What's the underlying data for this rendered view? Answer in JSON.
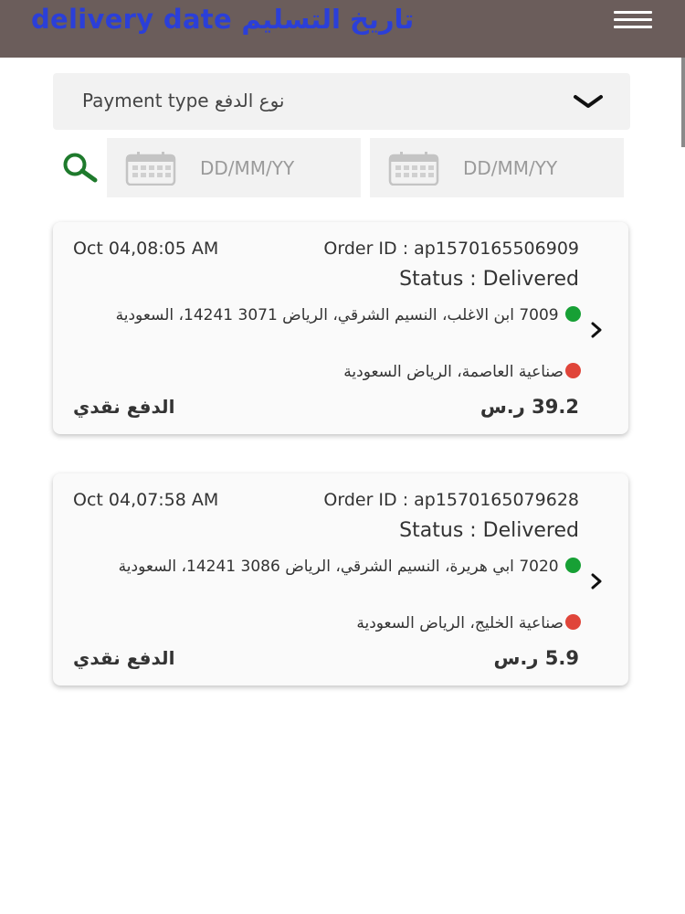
{
  "header": {
    "title": "delivery date تاريخ التسليم",
    "menu_icon": "hamburger-menu-icon"
  },
  "filters": {
    "payment_type_label": "Payment type نوع الدفع",
    "dropdown_icon": "chevron-down-icon",
    "search_icon": "search-icon",
    "date_from_placeholder": "DD/MM/YY",
    "date_to_placeholder": "DD/MM/YY",
    "calendar_icon": "calendar-icon"
  },
  "orders": [
    {
      "datetime": "Oct 04,08:05 AM",
      "order_id": "Order ID : ap1570165506909",
      "status": "Status : Delivered",
      "pickup_address": "7009 ابن الاغلب، النسيم الشرقي، الرياض 3071 14241، السعودية",
      "dropoff_address": "صناعية العاصمة، الرياض السعودية",
      "payment_method": "الدفع نقدي",
      "amount": "39.2 ر.س"
    },
    {
      "datetime": "Oct 04,07:58 AM",
      "order_id": "Order ID : ap1570165079628",
      "status": "Status : Delivered",
      "pickup_address": "7020 ابي هريرة، النسيم الشرقي، الرياض 3086 14241، السعودية",
      "dropoff_address": "صناعية الخليج، الرياض السعودية",
      "payment_method": "الدفع نقدي",
      "amount": "5.9 ر.س"
    }
  ],
  "colors": {
    "header_bg": "#6b5d5b",
    "title": "#2b3fd8",
    "search_icon": "#1e7a2c",
    "pickup_dot": "#17a035",
    "dropoff_dot": "#e0453a"
  }
}
